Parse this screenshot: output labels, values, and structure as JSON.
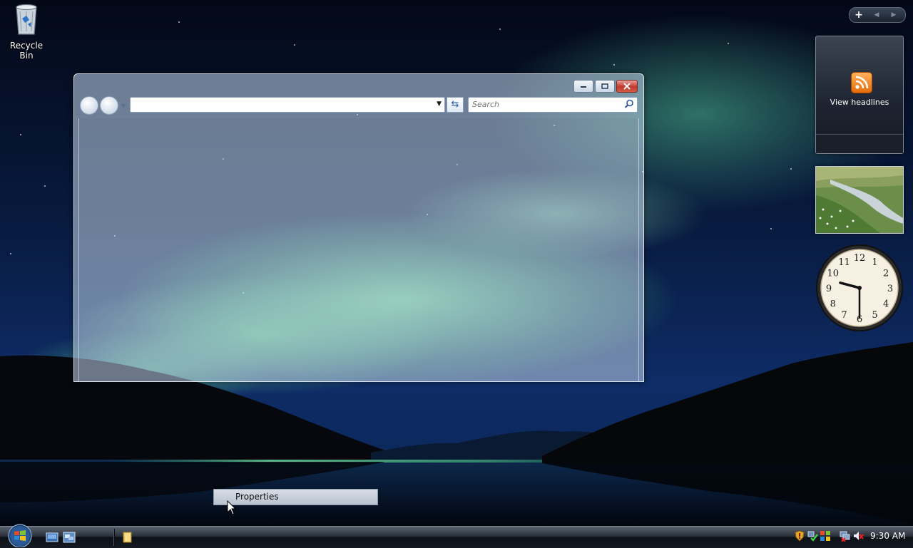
{
  "desktop": {
    "icons": [
      {
        "label": "Recycle Bin",
        "icon": "recycle-bin-icon"
      }
    ]
  },
  "window": {
    "controls": [
      "minimize",
      "maximize",
      "close"
    ],
    "address_value": "",
    "search": {
      "placeholder": "Search",
      "value": ""
    }
  },
  "sidebar": {
    "feed_headlines": {
      "label": "View headlines",
      "icon": "rss-feed-icon"
    },
    "slideshow": {
      "icon": "landscape-photo"
    },
    "clock": {
      "hour": 9,
      "minute": 30,
      "numerals": [
        "12",
        "1",
        "2",
        "3",
        "4",
        "5",
        "6",
        "7",
        "8",
        "9",
        "10",
        "11"
      ]
    }
  },
  "context_menu": {
    "items": [
      "Properties"
    ]
  },
  "taskbar": {
    "quick_launch": [
      "show-desktop-icon",
      "switch-windows-icon"
    ],
    "pinned": [
      "folder-icon"
    ],
    "tray_icons": [
      "security-shield-icon",
      "network-check-icon",
      "windows-flag-icon",
      "network-disconnected-icon",
      "volume-muted-icon"
    ],
    "clock": "9:30 AM"
  },
  "colors": {
    "aurora": "#7ee8a0",
    "sky": "#0e2c66",
    "taskbar": "#141922",
    "rss": "#f07d1f"
  }
}
